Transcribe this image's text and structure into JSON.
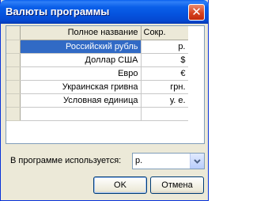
{
  "window": {
    "title": "Валюты программы",
    "close_glyph": "✕"
  },
  "grid": {
    "columns": [
      "Полное название",
      "Сокр."
    ],
    "rows": [
      {
        "name": "Российский рубль",
        "short": "р."
      },
      {
        "name": "Доллар США",
        "short": "$"
      },
      {
        "name": "Евро",
        "short": "€"
      },
      {
        "name": "Украинская гривна",
        "short": "грн."
      },
      {
        "name": "Условная единица",
        "short": "у. е."
      },
      {
        "name": "",
        "short": ""
      }
    ]
  },
  "currency_selector": {
    "label": "В программе используется:",
    "value": "р."
  },
  "buttons": {
    "ok": "OK",
    "cancel": "Отмена"
  },
  "icons": {
    "close": "close-icon",
    "dropdown": "chevron-down-icon"
  }
}
